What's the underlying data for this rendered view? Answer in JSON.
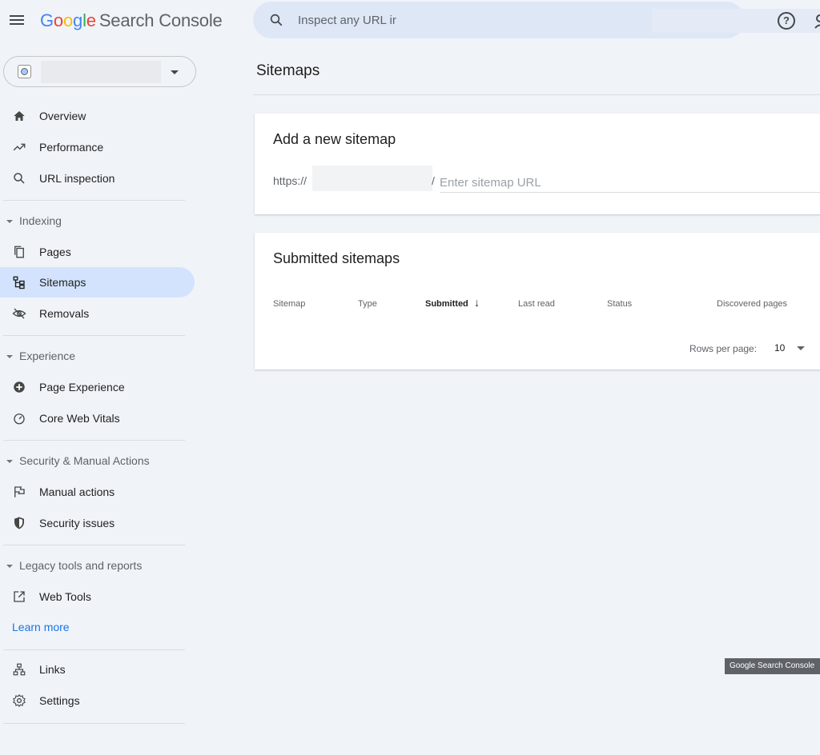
{
  "header": {
    "logo": {
      "G": "G",
      "o1": "o",
      "o2": "o",
      "g": "g",
      "l": "l",
      "e": "e",
      "product": "Search Console"
    },
    "search_placeholder": "Inspect any URL ir",
    "icons": {
      "menu": "hamburger-menu-icon",
      "search": "search-icon",
      "help": "help-circle-icon",
      "account": "account-icon"
    }
  },
  "property": {
    "icon": "globe-icon"
  },
  "sidebar": {
    "top_items": [
      {
        "label": "Overview",
        "icon": "home-icon"
      },
      {
        "label": "Performance",
        "icon": "trending-icon"
      },
      {
        "label": "URL inspection",
        "icon": "search-icon"
      }
    ],
    "sections": [
      {
        "title": "Indexing",
        "items": [
          {
            "label": "Pages",
            "icon": "pages-icon"
          },
          {
            "label": "Sitemaps",
            "icon": "sitemap-icon",
            "active": true
          },
          {
            "label": "Removals",
            "icon": "removals-icon"
          }
        ]
      },
      {
        "title": "Experience",
        "items": [
          {
            "label": "Page Experience",
            "icon": "page-experience-icon"
          },
          {
            "label": "Core Web Vitals",
            "icon": "gauge-icon"
          }
        ]
      },
      {
        "title": "Security & Manual Actions",
        "items": [
          {
            "label": "Manual actions",
            "icon": "flag-icon"
          },
          {
            "label": "Security issues",
            "icon": "shield-icon"
          }
        ]
      },
      {
        "title": "Legacy tools and reports",
        "items": [
          {
            "label": "Web Tools",
            "icon": "external-link-icon"
          }
        ]
      }
    ],
    "learn_more": "Learn more",
    "bottom_items": [
      {
        "label": "Links",
        "icon": "links-icon"
      },
      {
        "label": "Settings",
        "icon": "settings-icon"
      }
    ]
  },
  "main": {
    "title": "Sitemaps",
    "add_card": {
      "title": "Add a new sitemap",
      "prefix": "https://",
      "separator": "/",
      "input_placeholder": "Enter sitemap URL"
    },
    "submitted_card": {
      "title": "Submitted sitemaps",
      "columns": [
        "Sitemap",
        "Type",
        "Submitted",
        "Last read",
        "Status",
        "Discovered pages"
      ],
      "sort_icon": "arrow-down-icon",
      "rows_per_page_label": "Rows per page:",
      "rows_per_page_value": "10"
    }
  },
  "tooltip": "Google Search Console",
  "colors": {
    "background": "#f0f4f9",
    "active_nav": "#d3e3fd",
    "link": "#1a73e8",
    "search_bar": "#dde7f6"
  }
}
